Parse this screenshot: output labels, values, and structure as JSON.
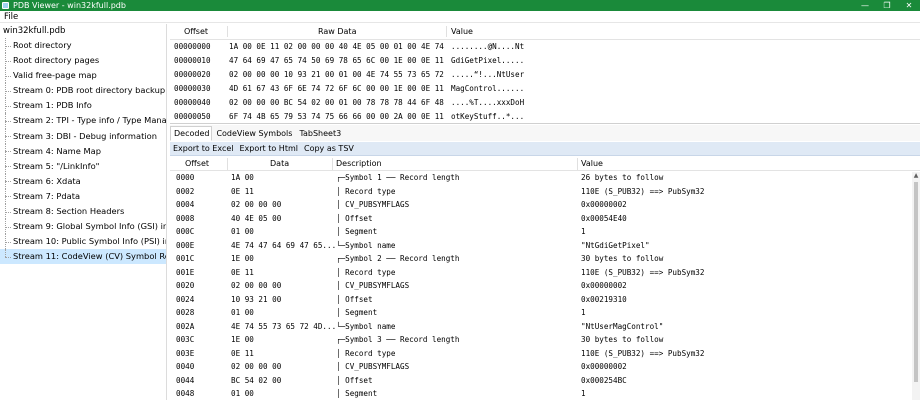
{
  "window": {
    "title": "PDB Viewer - win32kfull.pdb",
    "minimize": "—",
    "maximize": "❐",
    "close": "✕"
  },
  "menu": {
    "file": "File"
  },
  "tree": {
    "root": "win32kfull.pdb",
    "items": [
      "Root directory",
      "Root directory pages",
      "Valid free-page map",
      "Stream 0: PDB root directory backup",
      "Stream 1: PDB Info",
      "Stream 2: TPI - Type info / Type Manager",
      "Stream 3: DBI - Debug information",
      "Stream 4: Name Map",
      "Stream 5: \"/LinkInfo\"",
      "Stream 6: Xdata",
      "Stream 7: Pdata",
      "Stream 8: Section Headers",
      "Stream 9: Global Symbol Info (GSI) indexes",
      "Stream 10: Public Symbol Info (PSI) indexes",
      "Stream 11: CodeView (CV) Symbol Records"
    ],
    "selected_index": 14
  },
  "raw": {
    "headers": {
      "offset": "Offset",
      "data": "Raw Data",
      "value": "Value"
    },
    "rows": [
      {
        "offset": "00000000",
        "data": "1A 00 0E 11 02 00 00 00 40 4E 05 00 01 00 4E 74",
        "value": "........@N....Nt"
      },
      {
        "offset": "00000010",
        "data": "47 64 69 47 65 74 50 69 78 65 6C 00 1E 00 0E 11",
        "value": "GdiGetPixel....."
      },
      {
        "offset": "00000020",
        "data": "02 00 00 00 10 93 21 00 01 00 4E 74 55 73 65 72",
        "value": ".....“!...NtUser"
      },
      {
        "offset": "00000030",
        "data": "4D 61 67 43 6F 6E 74 72 6F 6C 00 00 1E 00 0E 11",
        "value": "MagControl......"
      },
      {
        "offset": "00000040",
        "data": "02 00 00 00 BC 54 02 00 01 00 78 78 78 44 6F 48",
        "value": "....%T....xxxDoH"
      },
      {
        "offset": "00000050",
        "data": "6F 74 4B 65 79 53 74 75 66 66 00 00 2A 00 0E 11",
        "value": "otKeyStuff..*..."
      }
    ]
  },
  "tabs": [
    {
      "label": "Decoded",
      "active": true
    },
    {
      "label": "CodeView Symbols",
      "active": false
    },
    {
      "label": "TabSheet3",
      "active": false
    }
  ],
  "toolbar": {
    "export_excel": "Export to Excel",
    "export_html": "Export to Html",
    "copy_tsv": "Copy as TSV"
  },
  "decoded": {
    "headers": {
      "offset": "Offset",
      "data": "Data",
      "description": "Description",
      "value": "Value"
    },
    "rows": [
      {
        "offset": "0000",
        "data": "1A 00",
        "desc": "┌─Symbol 1 ── Record length",
        "value": "26 bytes to follow"
      },
      {
        "offset": "0002",
        "data": "0E 11",
        "desc": "│ Record type",
        "value": "110E (S_PUB32) ==> PubSym32"
      },
      {
        "offset": "0004",
        "data": "02 00 00 00",
        "desc": "│ CV_PUBSYMFLAGS",
        "value": "0x00000002"
      },
      {
        "offset": "0008",
        "data": "40 4E 05 00",
        "desc": "│ Offset",
        "value": "0x00054E40"
      },
      {
        "offset": "000C",
        "data": "01 00",
        "desc": "│ Segment",
        "value": "1"
      },
      {
        "offset": "000E",
        "data": "4E 74 47 64 69 47 65...",
        "desc": "└─Symbol name",
        "value": "\"NtGdiGetPixel\""
      },
      {
        "offset": "001C",
        "data": "1E 00",
        "desc": "┌─Symbol 2 ── Record length",
        "value": "30 bytes to follow"
      },
      {
        "offset": "001E",
        "data": "0E 11",
        "desc": "│ Record type",
        "value": "110E (S_PUB32) ==> PubSym32"
      },
      {
        "offset": "0020",
        "data": "02 00 00 00",
        "desc": "│ CV_PUBSYMFLAGS",
        "value": "0x00000002"
      },
      {
        "offset": "0024",
        "data": "10 93 21 00",
        "desc": "│ Offset",
        "value": "0x00219310"
      },
      {
        "offset": "0028",
        "data": "01 00",
        "desc": "│ Segment",
        "value": "1"
      },
      {
        "offset": "002A",
        "data": "4E 74 55 73 65 72 4D...",
        "desc": "└─Symbol name",
        "value": "\"NtUserMagControl\""
      },
      {
        "offset": "003C",
        "data": "1E 00",
        "desc": "┌─Symbol 3 ── Record length",
        "value": "30 bytes to follow"
      },
      {
        "offset": "003E",
        "data": "0E 11",
        "desc": "│ Record type",
        "value": "110E (S_PUB32) ==> PubSym32"
      },
      {
        "offset": "0040",
        "data": "02 00 00 00",
        "desc": "│ CV_PUBSYMFLAGS",
        "value": "0x00000002"
      },
      {
        "offset": "0044",
        "data": "BC 54 02 00",
        "desc": "│ Offset",
        "value": "0x000254BC"
      },
      {
        "offset": "0048",
        "data": "01 00",
        "desc": "│ Segment",
        "value": "1"
      }
    ]
  }
}
